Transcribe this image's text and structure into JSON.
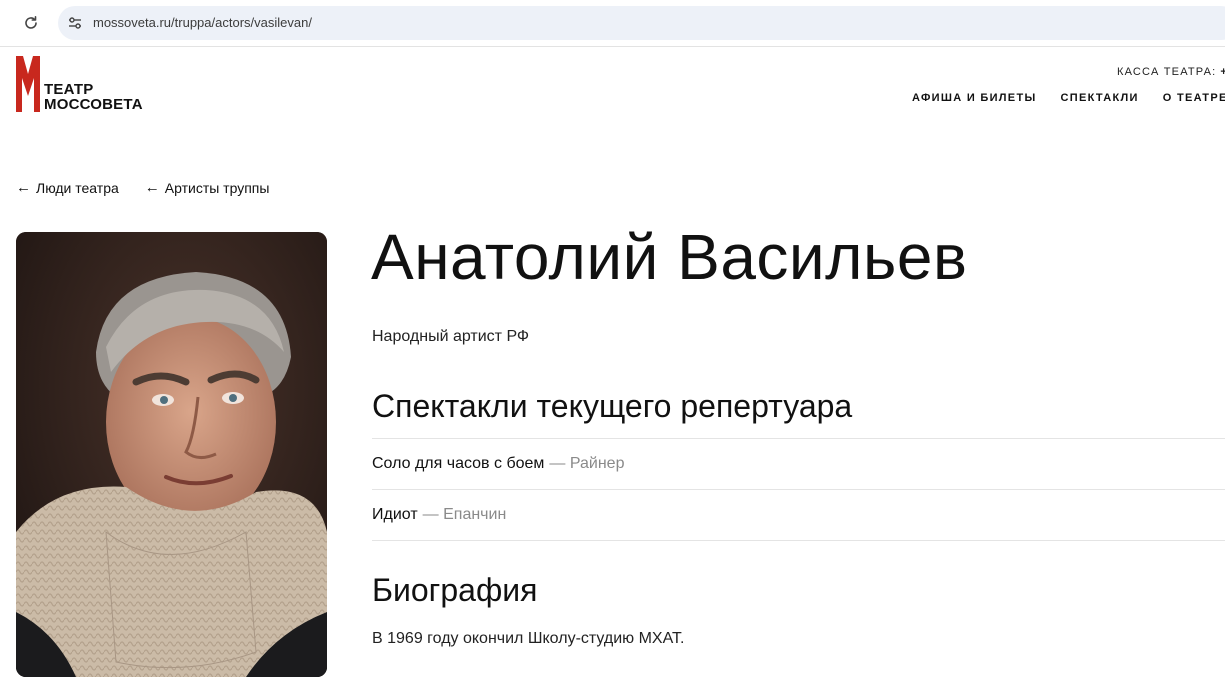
{
  "browser": {
    "url": "mossoveta.ru/truppa/actors/vasilevan/"
  },
  "header": {
    "logo_line1": "ТЕАТР",
    "logo_line2": "МОССОВЕТА",
    "kassa_label": "КАССА ТЕАТРА:",
    "kassa_phone_fragment": "+",
    "nav": [
      {
        "label": "АФИША И БИЛЕТЫ"
      },
      {
        "label": "СПЕКТАКЛИ"
      },
      {
        "label": "О ТЕАТРЕ"
      }
    ],
    "brand_color": "#c8281e"
  },
  "breadcrumbs": [
    {
      "label": "Люди театра"
    },
    {
      "label": "Артисты труппы"
    }
  ],
  "actor": {
    "name": "Анатолий Васильев",
    "title": "Народный артист РФ"
  },
  "repertoire": {
    "heading": "Спектакли текущего репертуара",
    "items": [
      {
        "play": "Соло для часов с боем",
        "role": "— Райнер"
      },
      {
        "play": "Идиот",
        "role": "— Епанчин"
      }
    ]
  },
  "biography": {
    "heading": "Биография",
    "text": "В 1969 году окончил Школу-студию МХАТ."
  }
}
